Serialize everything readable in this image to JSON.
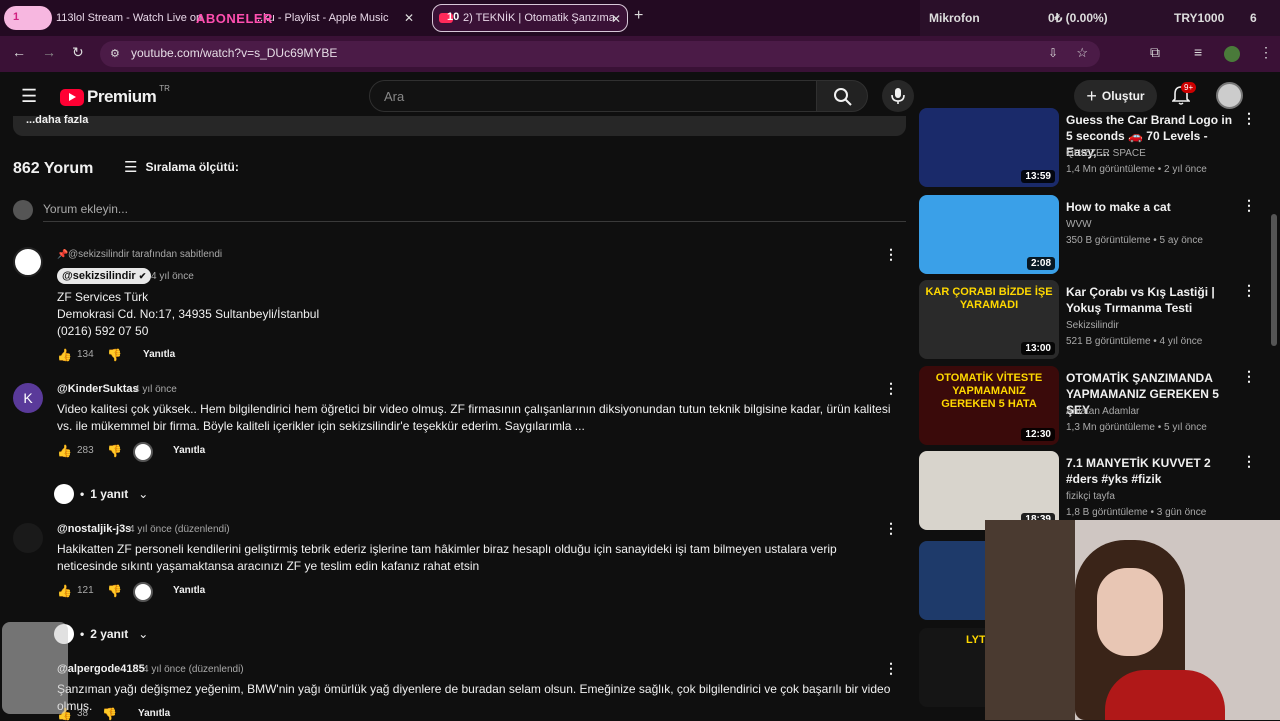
{
  "browser": {
    "tabs": [
      {
        "label": "113lol Stream - Watch Live on",
        "badge": "1"
      },
      {
        "label": "...ku - Playlist - Apple Music",
        "overlay": "ABONELER"
      },
      {
        "label": "2) TEKNİK | Otomatik Şanzıma",
        "badge": "10"
      }
    ],
    "new_tab": "+",
    "stats": {
      "mic": "Mikrofon",
      "pct": "0₺ (0.00%)",
      "amount": "TRY1000",
      "num": "6"
    },
    "url": "youtube.com/watch?v=s_DUc69MYBE"
  },
  "yt": {
    "logo": "Premium",
    "logo_sup": "TR",
    "search_placeholder": "Ara",
    "create": "Oluştur",
    "notif_badge": "9+"
  },
  "comments": {
    "more": "...daha fazla",
    "count": "862 Yorum",
    "sort": "Sıralama ölçütü:",
    "add_placeholder": "Yorum ekleyin...",
    "items": [
      {
        "pinned": "@sekizsilindir tarafından sabitlendi",
        "user": "@sekizsilindir",
        "time": "4 yıl önce",
        "lines": [
          "ZF Services Türk",
          "Demokrasi Cd. No:17, 34935 Sultanbeyli/İstanbul",
          "(0216) 592 07 50"
        ],
        "likes": "134",
        "reply": "Yanıtla"
      },
      {
        "user": "@KinderSuktas",
        "time": "4 yıl önce",
        "avatar_letter": "K",
        "text": "Video kalitesi çok yüksek.. Hem bilgilendirici hem öğretici bir video olmuş. ZF firmasının çalışanlarının diksiyonundan tutun teknik bilgisine kadar, ürün kalitesi vs. ile mükemmel bir firma. Böyle kaliteli içerikler için sekizsilindir'e teşekkür ederim. Saygılarımla ...",
        "likes": "283",
        "reply": "Yanıtla",
        "replies": "1 yanıt"
      },
      {
        "user": "@nostaljik-j3s",
        "time": "4 yıl önce (düzenlendi)",
        "text": "Hakikatten ZF personeli kendilerini geliştirmiş tebrik ederiz işlerine tam hâkimler biraz hesaplı olduğu için sanayideki işi tam bilmeyen ustalara verip neticesinde sıkıntı yaşamaktansa aracınızı ZF ye teslim edin kafanız rahat etsin",
        "likes": "121",
        "reply": "Yanıtla",
        "replies": "2 yanıt"
      },
      {
        "user": "@alpergode4185",
        "time": "4 yıl önce (düzenlendi)",
        "text": "Şanzıman yağı değişmez yeğenim, BMW'nin yağı ömürlük yağ diyenlere de buradan selam olsun. Emeğinize sağlık, çok bilgilendirici ve çok başarılı bir video olmuş.",
        "likes": "38",
        "reply": "Yanıtla"
      }
    ]
  },
  "sidebar": {
    "videos": [
      {
        "title": "Guess the Car Brand Logo in 5 seconds 🚗 70 Levels - Easy, ...",
        "channel": "QUIZZER SPACE",
        "meta": "1,4 Mn görüntüleme • 2 yıl önce",
        "duration": "13:59",
        "thumb_color": "#1a2a6a"
      },
      {
        "title": "How to make a cat",
        "channel": "WVW",
        "meta": "350 B görüntüleme • 5 ay önce",
        "duration": "2:08",
        "thumb_color": "#3aa0e8"
      },
      {
        "title": "Kar Çorabı vs Kış Lastiği | Yokuş Tırmanma Testi",
        "channel": "Sekizsilindir",
        "meta": "521 B görüntüleme • 4 yıl önce",
        "duration": "13:00",
        "thumb_color": "#2a2a2a",
        "thumb_text": "KAR ÇORABI BİZDE İŞE YARAMADI"
      },
      {
        "title": "OTOMATİK ŞANZIMANDA YAPMAMANIZ GEREKEN 5 ŞEY",
        "channel": "Anlatan Adamlar",
        "meta": "1,3 Mn görüntüleme • 5 yıl önce",
        "duration": "12:30",
        "thumb_color": "#3a0a0a",
        "thumb_text": "OTOMATİK VİTESTE YAPMAMANIZ GEREKEN 5 HATA"
      },
      {
        "title": "7.1 MANYETİK KUVVET 2 #ders #yks #fizik",
        "channel": "fizikçi tayfa",
        "meta": "1,8 B görüntüleme • 3 gün önce",
        "duration": "18:39",
        "thumb_color": "#d8d4cc"
      },
      {
        "title": "",
        "channel": "",
        "meta": "",
        "duration": "",
        "thumb_color": "#1e3a6a"
      },
      {
        "title": "",
        "channel": "",
        "meta": "",
        "duration": "",
        "thumb_color": "#151515",
        "thumb_text": "LYTHEIA"
      }
    ]
  },
  "colors": {
    "accent": "#ff0033",
    "bg": "#0f0f0f",
    "tabbar": "#230a22",
    "addr": "#3a1136"
  }
}
